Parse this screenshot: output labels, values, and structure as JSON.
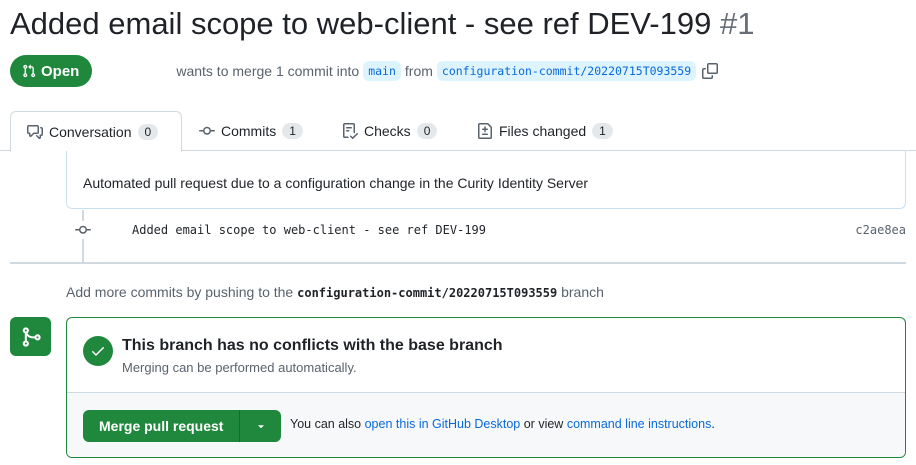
{
  "pr": {
    "title": "Added email scope to web-client - see ref DEV-199",
    "number": "#1",
    "state": "Open",
    "wants_to_merge": "wants to merge 1 commit into",
    "base_branch": "main",
    "from_label": "from",
    "head_branch": "configuration-commit/20220715T093559"
  },
  "tabs": [
    {
      "label": "Conversation",
      "count": "0",
      "icon": "comment-discussion-icon"
    },
    {
      "label": "Commits",
      "count": "1",
      "icon": "git-commit-icon"
    },
    {
      "label": "Checks",
      "count": "0",
      "icon": "checklist-icon"
    },
    {
      "label": "Files changed",
      "count": "1",
      "icon": "file-diff-icon"
    }
  ],
  "description": "Automated pull request due to a configuration change in the Curity Identity Server",
  "commit": {
    "message": "Added email scope to web-client - see ref DEV-199",
    "sha": "c2ae8ea"
  },
  "push_note": {
    "before": "Add more commits by pushing to the",
    "branch": "configuration-commit/20220715T093559",
    "after": "branch"
  },
  "merge": {
    "status_title": "This branch has no conflicts with the base branch",
    "status_sub": "Merging can be performed automatically.",
    "button_label": "Merge pull request",
    "help_prefix": "You can also",
    "desktop_link": "open this in GitHub Desktop",
    "help_middle": "or view",
    "cli_link": "command line instructions",
    "help_suffix": "."
  },
  "colors": {
    "accent_green": "#1f883d",
    "link_blue": "#0969da",
    "branch_bg": "#ddf4ff"
  }
}
